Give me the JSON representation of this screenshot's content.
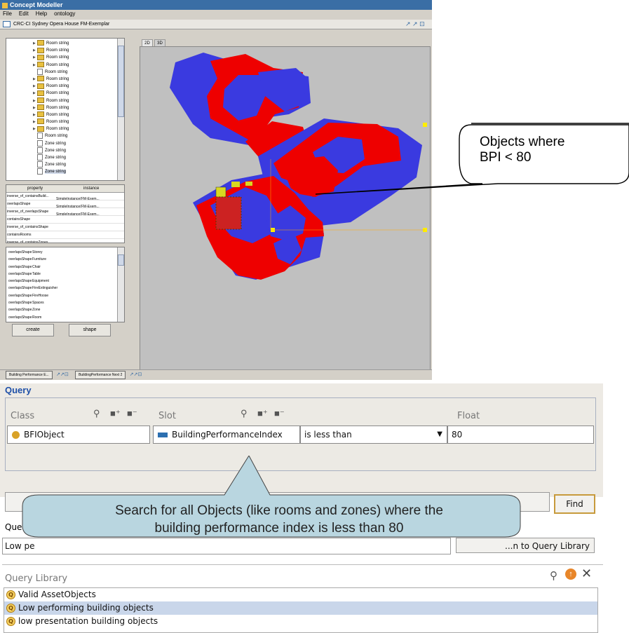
{
  "window": {
    "title": "Concept Modeller",
    "menu": [
      "File",
      "Edit",
      "Help",
      "ontology"
    ],
    "frame_title": "CRC-CI Sydney Opera House FM-Exemplar",
    "frame_buttons": "↗ ↗ ⊡"
  },
  "tree": {
    "items": [
      {
        "label": "Room string",
        "type": "folder",
        "expandable": true
      },
      {
        "label": "Room string",
        "type": "folder",
        "expandable": true
      },
      {
        "label": "Room string",
        "type": "folder",
        "expandable": true
      },
      {
        "label": "Room string",
        "type": "folder",
        "expandable": true
      },
      {
        "label": "Room string",
        "type": "doc",
        "expandable": false
      },
      {
        "label": "Room string",
        "type": "folder",
        "expandable": true
      },
      {
        "label": "Room string",
        "type": "folder",
        "expandable": true
      },
      {
        "label": "Room string",
        "type": "folder",
        "expandable": true
      },
      {
        "label": "Room string",
        "type": "folder",
        "expandable": true
      },
      {
        "label": "Room string",
        "type": "folder",
        "expandable": true
      },
      {
        "label": "Room string",
        "type": "folder",
        "expandable": true
      },
      {
        "label": "Room string",
        "type": "folder",
        "expandable": true
      },
      {
        "label": "Room string",
        "type": "folder",
        "expandable": true
      },
      {
        "label": "Room string",
        "type": "doc",
        "expandable": false
      },
      {
        "label": "Zone string",
        "type": "doc",
        "expandable": false
      },
      {
        "label": "Zone string",
        "type": "doc",
        "expandable": false
      },
      {
        "label": "Zone string",
        "type": "doc",
        "expandable": false
      },
      {
        "label": "Zone string",
        "type": "doc",
        "expandable": false
      },
      {
        "label": "Zone string",
        "type": "doc",
        "expandable": false,
        "selected": true
      }
    ]
  },
  "property_grid": {
    "headers": [
      "property",
      "instance"
    ],
    "rows": [
      {
        "property": "inverse_of_containsBuild...",
        "instance": "SimpleInstance(FM-Exem..."
      },
      {
        "property": "overlapsShape",
        "instance": "SimpleInstance(FM-Exem..."
      },
      {
        "property": "inverse_of_overlapsShape",
        "instance": "SimpleInstance(FM-Exem..."
      },
      {
        "property": "containsShape",
        "instance": ""
      },
      {
        "property": "inverse_of_containsShape",
        "instance": ""
      },
      {
        "property": "containsRooms",
        "instance": ""
      },
      {
        "property": "inverse_of_containsZones",
        "instance": ""
      }
    ]
  },
  "relation_list": {
    "rows": [
      {
        "slot": "overlapsShape",
        "cls": "Storey"
      },
      {
        "slot": "overlapsShape",
        "cls": "Furniture"
      },
      {
        "slot": "overlapsShape",
        "cls": "Chair"
      },
      {
        "slot": "overlapsShape",
        "cls": "Table"
      },
      {
        "slot": "overlapsShape",
        "cls": "Equipment"
      },
      {
        "slot": "overlapsShape",
        "cls": "FireExtinguisher"
      },
      {
        "slot": "overlapsShape",
        "cls": "FireHoose"
      },
      {
        "slot": "overlapsShape",
        "cls": "Spaces"
      },
      {
        "slot": "overlapsShape",
        "cls": "Zone"
      },
      {
        "slot": "overlapsShape",
        "cls": "Room"
      }
    ]
  },
  "buttons": {
    "create": "create",
    "shape": "shape"
  },
  "view_tabs": [
    "2D",
    "3D"
  ],
  "status_tabs": [
    "Building Performance E...",
    "BuildingPerformance Next 2"
  ],
  "callout_top": {
    "line1": "Objects where",
    "line2": "BPI < 80"
  },
  "query": {
    "title": "Query",
    "class_header": "Class",
    "slot_header": "Slot",
    "float_header": "Float",
    "class_value": "BFIObject",
    "slot_value": "BuildingPerformanceIndex",
    "operator_value": "is less than",
    "float_value": "80",
    "find_label": "Find",
    "name_label": "Que",
    "name_value": "Low pe",
    "add_label": "...n to Query Library"
  },
  "callout_bottom": {
    "line1": "Search for all Objects (like rooms and zones) where the",
    "line2": "building performance index is less than 80"
  },
  "library": {
    "title": "Query Library",
    "items": [
      {
        "label": "Valid AssetObjects",
        "selected": false
      },
      {
        "label": "Low performing building objects",
        "selected": true
      },
      {
        "label": "low presentation building objects",
        "selected": false
      }
    ]
  },
  "colors": {
    "accent": "#1f50a8",
    "shape_red": "#ee0000",
    "shape_blue": "#3a3ae0",
    "selection": "#c9d6ea"
  }
}
